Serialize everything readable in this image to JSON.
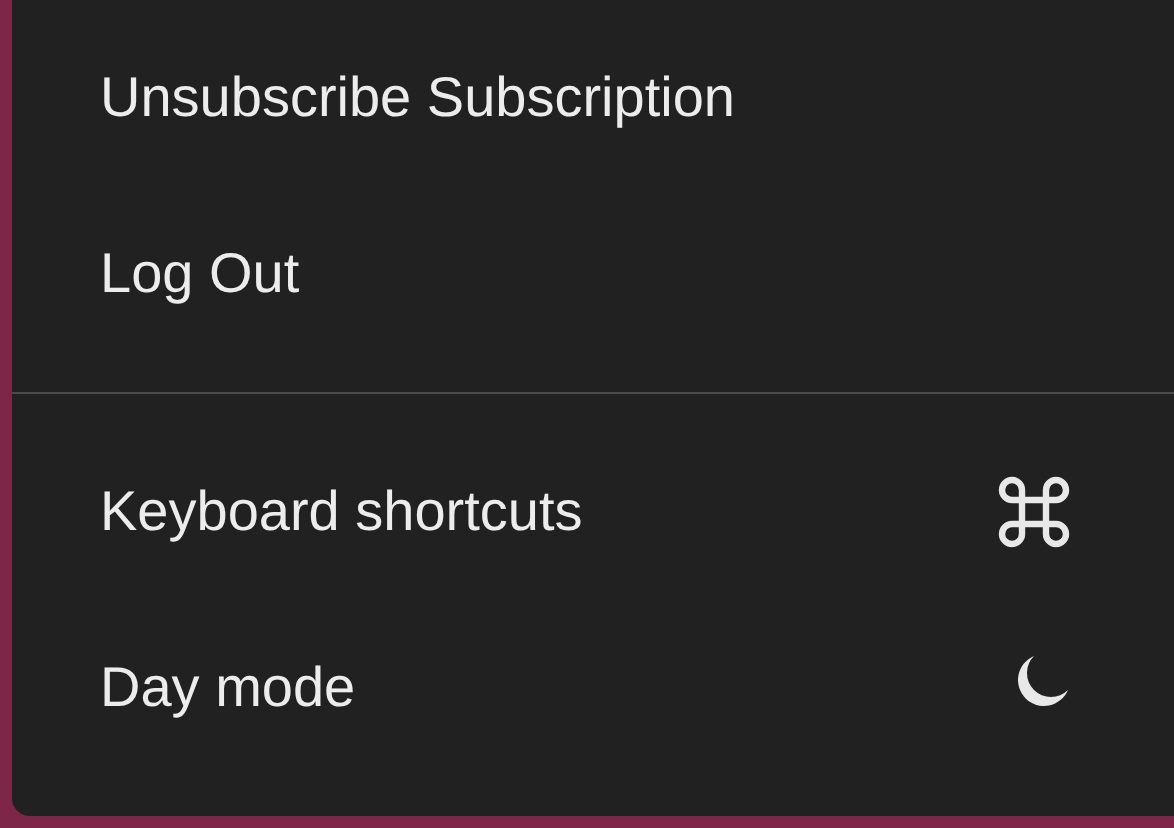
{
  "menu": {
    "groups": [
      {
        "items": [
          {
            "label": "Unsubscribe Subscription",
            "kind": "plain"
          },
          {
            "label": "Log Out",
            "kind": "plain"
          }
        ]
      },
      {
        "items": [
          {
            "label": "Keyboard shortcuts",
            "kind": "shortcuts"
          },
          {
            "label": "Day mode",
            "kind": "theme"
          }
        ]
      }
    ]
  }
}
